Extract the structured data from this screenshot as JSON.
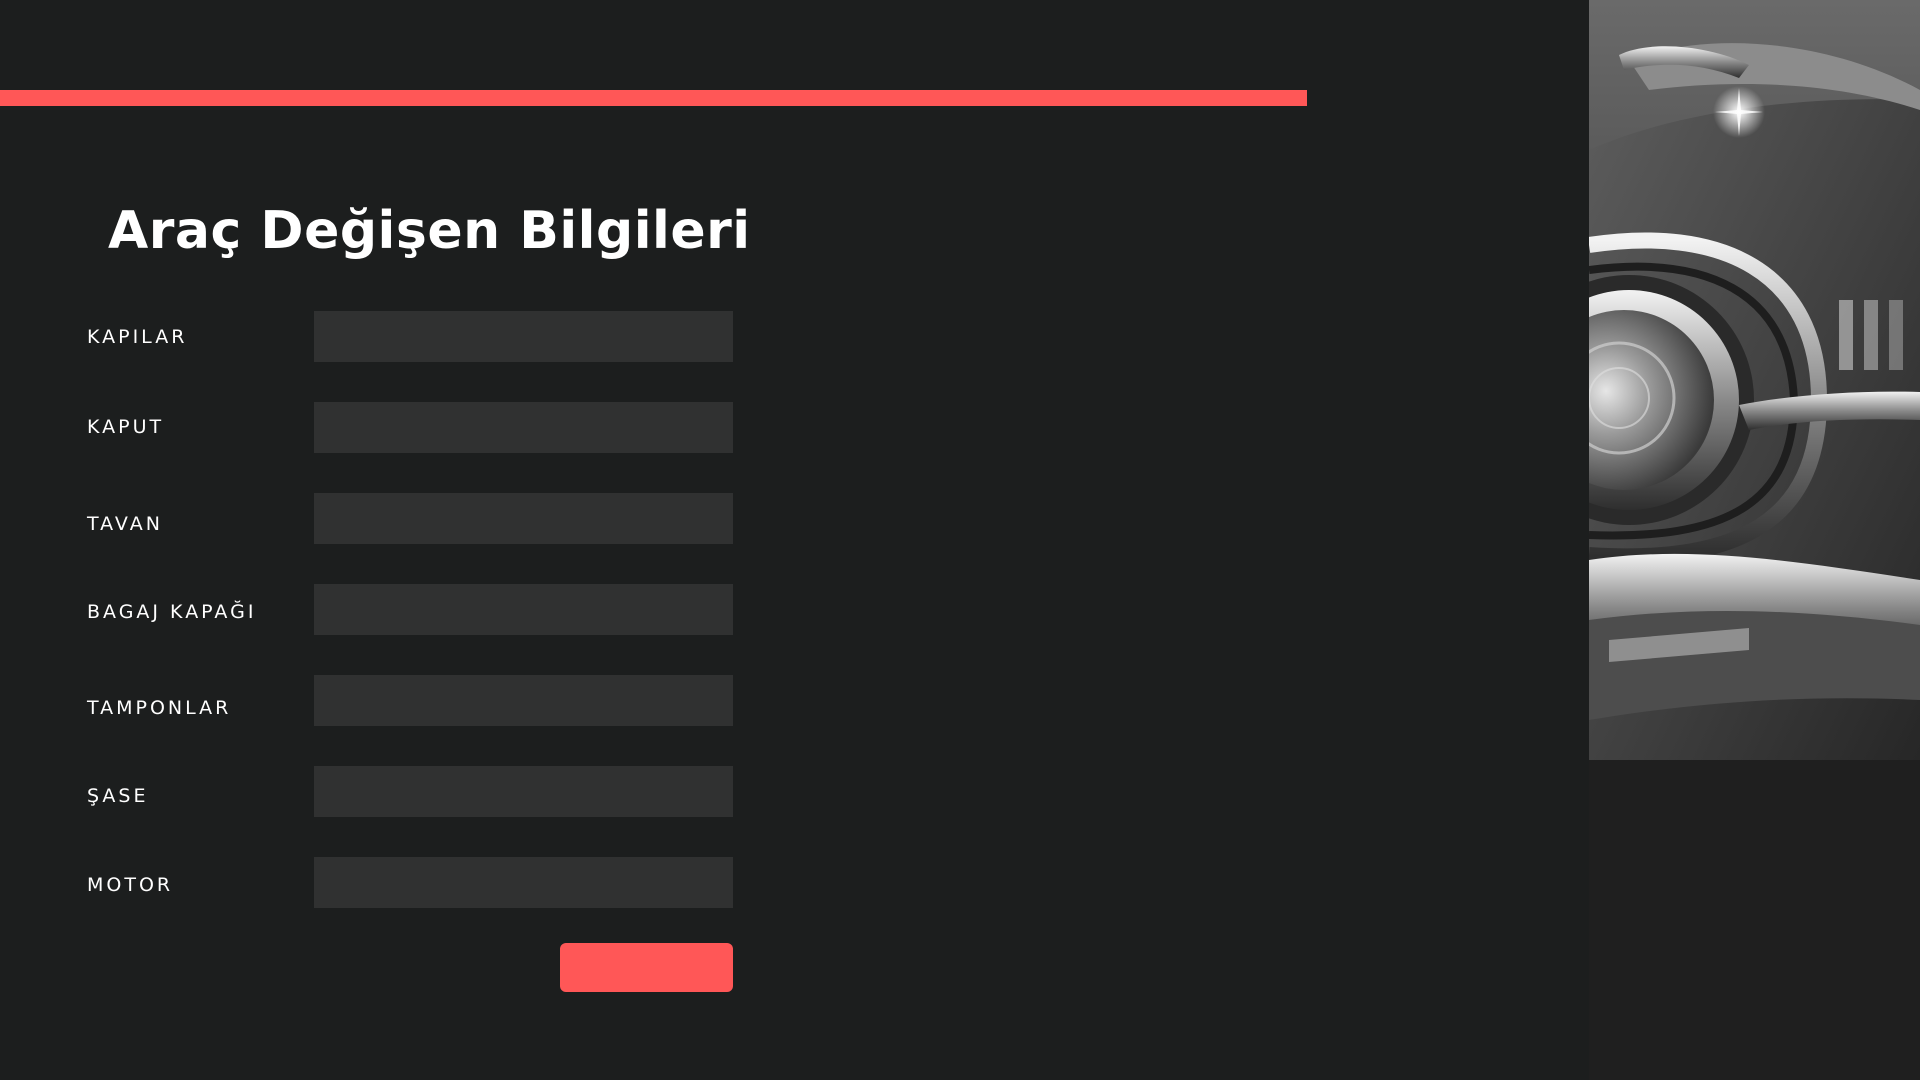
{
  "form": {
    "title": "Araç Değişen Bilgileri",
    "fields": [
      {
        "label": "KAPILAR",
        "value": ""
      },
      {
        "label": "KAPUT",
        "value": ""
      },
      {
        "label": "TAVAN",
        "value": ""
      },
      {
        "label": "BAGAJ KAPAĞI",
        "value": ""
      },
      {
        "label": "TAMPONLAR",
        "value": ""
      },
      {
        "label": "ŞASE",
        "value": ""
      },
      {
        "label": "MOTOR",
        "value": ""
      }
    ],
    "submit_label": ""
  },
  "colors": {
    "background": "#1c1e1e",
    "accent": "#ff5757",
    "input_background": "#303131",
    "text": "#ffffff"
  }
}
